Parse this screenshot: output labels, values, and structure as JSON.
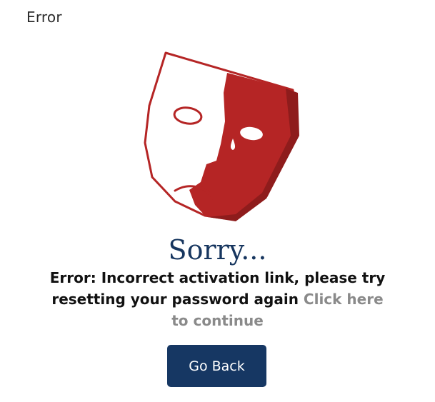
{
  "header": {
    "title": "Error"
  },
  "illustration": {
    "icon": "sad-mask-icon",
    "colors": {
      "red": "#b52525",
      "dark_red": "#8e1c1c",
      "outline": "#b52525"
    }
  },
  "heading": "Sorry...",
  "message": {
    "text": "Error: Incorrect activation link, please try resetting your password again",
    "link_text": "Click here to continue"
  },
  "actions": {
    "go_back_label": "Go Back"
  },
  "colors": {
    "heading": "#17365f",
    "button_bg": "#163763",
    "link": "#8a8a8a"
  }
}
